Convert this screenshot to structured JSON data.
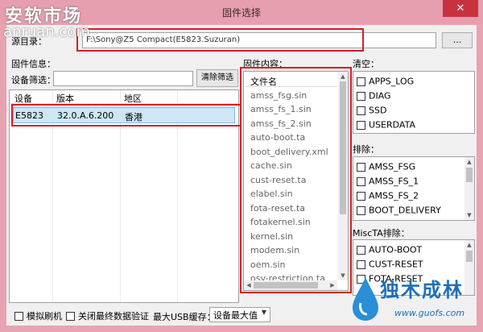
{
  "window": {
    "title": "固件选择",
    "close_glyph": "✕",
    "brand_text": "安软市场",
    "brand_url": "anruan.com"
  },
  "source": {
    "label": "源目录：",
    "path": "F:\\Sony@Z5 Compact(E5823.Suzuran)",
    "browse_label": "..."
  },
  "firmware_info": {
    "label": "固件信息：",
    "filter_label": "设备筛选：",
    "filter_value": "",
    "clear_filter_label": "清除筛选",
    "columns": [
      "设备",
      "版本",
      "地区"
    ],
    "rows": [
      {
        "device": "E5823",
        "version": "32.0.A.6.200",
        "region": "香港"
      }
    ]
  },
  "firmware_content": {
    "label": "固件内容：",
    "column_header": "文件名",
    "files": [
      "amss_fsg.sin",
      "amss_fs_1.sin",
      "amss_fs_2.sin",
      "auto-boot.ta",
      "boot_delivery.xml",
      "cache.sin",
      "cust-reset.ta",
      "elabel.sin",
      "fota-reset.ta",
      "fotakernel.sin",
      "kernel.sin",
      "modem.sin",
      "oem.sin",
      "osv-restriction.ta"
    ]
  },
  "wipe": {
    "label": "清空：",
    "items": [
      "APPS_LOG",
      "DIAG",
      "SSD",
      "USERDATA"
    ]
  },
  "exclude": {
    "label": "排除：",
    "items": [
      "AMSS_FSG",
      "AMSS_FS_1",
      "AMSS_FS_2",
      "BOOT_DELIVERY"
    ]
  },
  "miscta_exclude": {
    "label": "MiscTA排除：",
    "items": [
      "AUTO-BOOT",
      "CUST-RESET",
      "FOTA-RESET"
    ]
  },
  "bottom": {
    "simulate_label": "模拟刷机",
    "disable_verify_label": "关闭最终数据验证",
    "usb_buffer_label": "最大USB缓存：",
    "usb_buffer_value": "设备最大值"
  },
  "watermark": {
    "title": "独木成林",
    "url": "www.guofs.com"
  },
  "colors": {
    "highlight_red": "#d41e28",
    "close_red": "#c7323e",
    "selection_blue": "#cfe6f7"
  }
}
